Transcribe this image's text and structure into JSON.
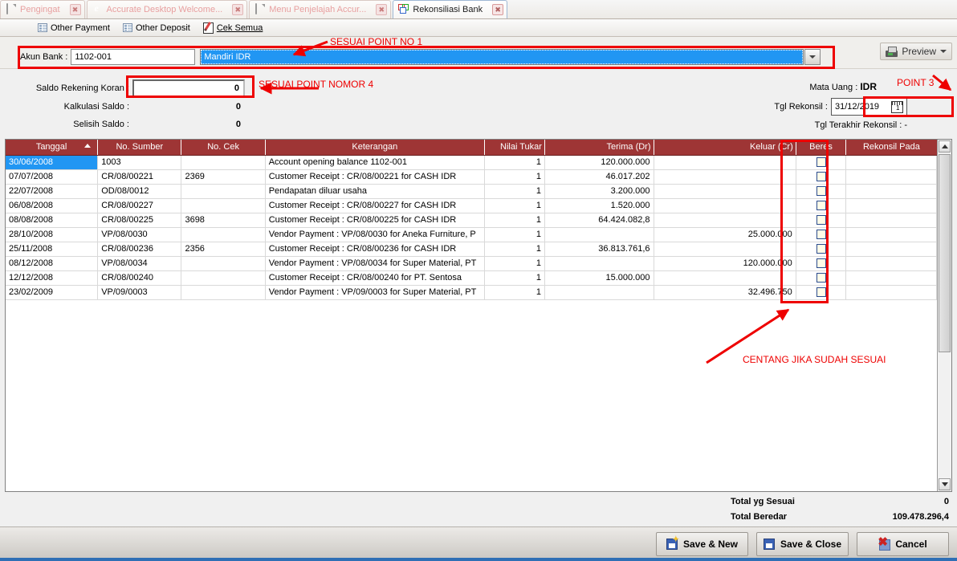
{
  "tabs": [
    {
      "label": "Pengingat",
      "icon": "document-icon",
      "active": false
    },
    {
      "label": "Accurate Desktop Welcome...",
      "icon": "internet-explorer-icon",
      "active": false
    },
    {
      "label": "Menu Penjelajah Accur...",
      "icon": "document-icon",
      "active": false
    },
    {
      "label": "Rekonsiliasi Bank",
      "icon": "windows-tile-icon",
      "active": true
    }
  ],
  "toolbar": {
    "other_payment": "Other Payment",
    "other_deposit": "Other Deposit",
    "cek_semua": "Cek Semua",
    "preview": "Preview"
  },
  "form": {
    "akun_bank_label": "Akun Bank :",
    "akun_bank_code": "1102-001",
    "akun_bank_name": "Mandiri IDR",
    "saldo_rekening_koran_label": "Saldo Rekening Koran :",
    "saldo_rekening_koran_value": "0",
    "kalkulasi_saldo_label": "Kalkulasi Saldo :",
    "kalkulasi_saldo_value": "0",
    "selisih_saldo_label": "Selisih Saldo :",
    "selisih_saldo_value": "0",
    "mata_uang_label": "Mata Uang :",
    "mata_uang_value": "IDR",
    "tgl_rekonsil_label": "Tgl Rekonsil :",
    "tgl_rekonsil_value": "31/12/2019",
    "tgl_terakhir_label": "Tgl Terakhir Rekonsil :",
    "tgl_terakhir_value": "-"
  },
  "grid": {
    "columns": [
      {
        "key": "tanggal",
        "label": "Tanggal",
        "sorted": true
      },
      {
        "key": "no_sumber",
        "label": "No. Sumber"
      },
      {
        "key": "no_cek",
        "label": "No. Cek"
      },
      {
        "key": "keterangan",
        "label": "Keterangan"
      },
      {
        "key": "nilai_tukar",
        "label": "Nilai Tukar"
      },
      {
        "key": "terima_dr",
        "label": "Terima (Dr)"
      },
      {
        "key": "keluar_cr",
        "label": "Keluar (Cr)"
      },
      {
        "key": "beres",
        "label": "Beres"
      },
      {
        "key": "rekonsil_pada",
        "label": "Rekonsil Pada"
      }
    ],
    "rows": [
      {
        "tanggal": "30/06/2008",
        "no_sumber": "1003",
        "no_cek": "",
        "keterangan": "Account opening balance  1102-001",
        "nilai_tukar": "1",
        "terima_dr": "120.000.000",
        "keluar_cr": "",
        "beres": false,
        "rekonsil_pada": "",
        "selected": true
      },
      {
        "tanggal": "07/07/2008",
        "no_sumber": "CR/08/00221",
        "no_cek": "2369",
        "keterangan": "Customer Receipt : CR/08/00221 for CASH IDR",
        "nilai_tukar": "1",
        "terima_dr": "46.017.202",
        "keluar_cr": "",
        "beres": false,
        "rekonsil_pada": ""
      },
      {
        "tanggal": "22/07/2008",
        "no_sumber": "OD/08/0012",
        "no_cek": "",
        "keterangan": "Pendapatan diluar usaha",
        "nilai_tukar": "1",
        "terima_dr": "3.200.000",
        "keluar_cr": "",
        "beres": false,
        "rekonsil_pada": ""
      },
      {
        "tanggal": "06/08/2008",
        "no_sumber": "CR/08/00227",
        "no_cek": "",
        "keterangan": "Customer Receipt : CR/08/00227 for CASH IDR",
        "nilai_tukar": "1",
        "terima_dr": "1.520.000",
        "keluar_cr": "",
        "beres": false,
        "rekonsil_pada": ""
      },
      {
        "tanggal": "08/08/2008",
        "no_sumber": "CR/08/00225",
        "no_cek": "3698",
        "keterangan": "Customer Receipt : CR/08/00225 for CASH IDR",
        "nilai_tukar": "1",
        "terima_dr": "64.424.082,8",
        "keluar_cr": "",
        "beres": false,
        "rekonsil_pada": ""
      },
      {
        "tanggal": "28/10/2008",
        "no_sumber": "VP/08/0030",
        "no_cek": "",
        "keterangan": "Vendor Payment : VP/08/0030 for Aneka Furniture, P",
        "nilai_tukar": "1",
        "terima_dr": "",
        "keluar_cr": "25.000.000",
        "beres": false,
        "rekonsil_pada": ""
      },
      {
        "tanggal": "25/11/2008",
        "no_sumber": "CR/08/00236",
        "no_cek": "2356",
        "keterangan": "Customer Receipt : CR/08/00236 for CASH IDR",
        "nilai_tukar": "1",
        "terima_dr": "36.813.761,6",
        "keluar_cr": "",
        "beres": false,
        "rekonsil_pada": ""
      },
      {
        "tanggal": "08/12/2008",
        "no_sumber": "VP/08/0034",
        "no_cek": "",
        "keterangan": "Vendor Payment : VP/08/0034 for Super Material, PT",
        "nilai_tukar": "1",
        "terima_dr": "",
        "keluar_cr": "120.000.000",
        "beres": false,
        "rekonsil_pada": ""
      },
      {
        "tanggal": "12/12/2008",
        "no_sumber": "CR/08/00240",
        "no_cek": "",
        "keterangan": "Customer Receipt : CR/08/00240 for PT. Sentosa",
        "nilai_tukar": "1",
        "terima_dr": "15.000.000",
        "keluar_cr": "",
        "beres": false,
        "rekonsil_pada": ""
      },
      {
        "tanggal": "23/02/2009",
        "no_sumber": "VP/09/0003",
        "no_cek": "",
        "keterangan": "Vendor Payment : VP/09/0003 for Super Material, PT",
        "nilai_tukar": "1",
        "terima_dr": "",
        "keluar_cr": "32.496.750",
        "beres": false,
        "rekonsil_pada": ""
      }
    ]
  },
  "totals": {
    "total_sesuai_label": "Total yg Sesuai",
    "total_sesuai_value": "0",
    "total_beredar_label": "Total Beredar",
    "total_beredar_value": "109.478.296,4"
  },
  "footer": {
    "save_new": "Save & New",
    "save_close": "Save & Close",
    "cancel": "Cancel"
  },
  "annotations": {
    "point1": "SESUAI POINT NO 1",
    "point4": "SESUAI POINT NOMOR 4",
    "point3": "POINT 3",
    "centang": "CENTANG JIKA SUDAH SESUAI",
    "color": "#ee0000"
  }
}
